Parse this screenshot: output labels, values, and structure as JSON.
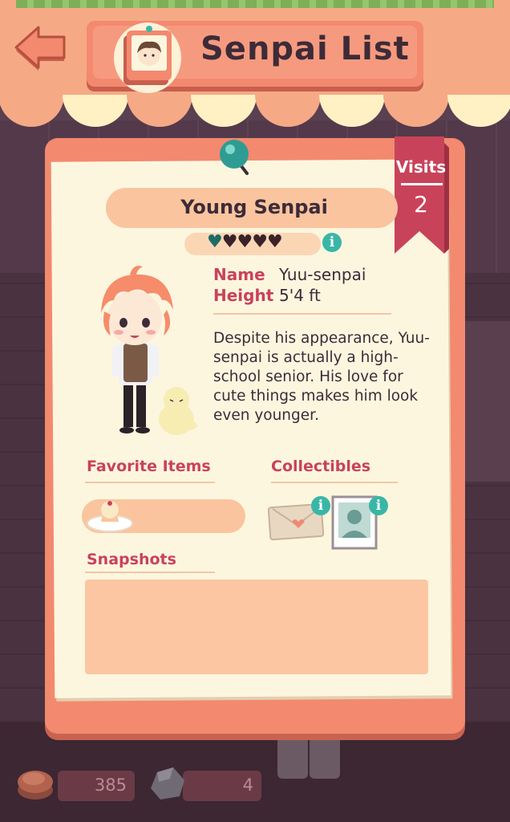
{
  "header": {
    "title": "Senpai List",
    "back_icon": "back-arrow-icon",
    "book_icon": "senpai-book-icon"
  },
  "profile": {
    "type": "Young Senpai",
    "visits_label": "Visits",
    "visits_value": "2",
    "affection": {
      "filled": 1,
      "total": 5
    },
    "name_label": "Name",
    "name_value": "Yuu-senpai",
    "height_label": "Height",
    "height_value": "5'4 ft",
    "description": "Despite his appearance, Yuu-senpai is actually a high-school senior. His love for cute things makes him look even younger."
  },
  "sections": {
    "favorite_items": "Favorite Items",
    "collectibles": "Collectibles",
    "snapshots": "Snapshots"
  },
  "favorite_items": [
    "cupcake-on-plate-icon"
  ],
  "collectibles": [
    "love-letter-icon",
    "silhouette-photo-icon"
  ],
  "currency": {
    "coins": "385",
    "rocks": "4"
  },
  "colors": {
    "accent": "#f3896f",
    "label": "#c9425b",
    "text": "#3d2b38",
    "info": "#3ab6a6",
    "ribbon": "#c8435a"
  }
}
